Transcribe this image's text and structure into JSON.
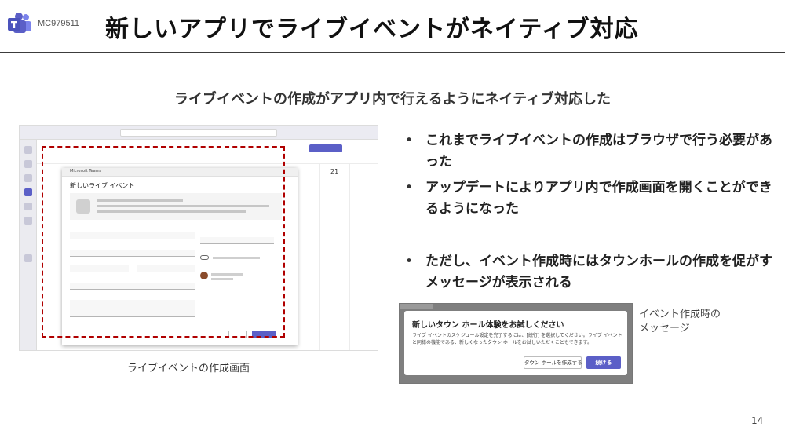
{
  "header": {
    "mc_id": "MC979511",
    "title": "新しいアプリでライブイベントがネイティブ対応"
  },
  "subtitle": "ライブイベントの作成がアプリ内で行えるようにネイティブ対応した",
  "left_caption": "ライブイベントの作成画面",
  "screenshot": {
    "window_label": "Microsoft Teams",
    "dialog_title": "新しいライブ イベント",
    "calendar_day": "21"
  },
  "bullets": [
    "これまでライブイベントの作成はブラウザで行う必要があった",
    "アップデートによりアプリ内で作成画面を開くことができるようになった",
    "ただし、イベント作成時にはタウンホールの作成を促がすメッセージが表示される"
  ],
  "message": {
    "title": "新しいタウン ホール体験をお試しください",
    "body": "ライブ イベントのスケジュール設定を完了するには、[続行] を選択してください。ライブ イベントと同様の機能である、新しくなったタウン ホールをお試しいただくこともできます。",
    "create_town_hall_label": "タウン ホールを作成する",
    "continue_label": "続ける"
  },
  "right_caption": [
    "イベント作成時の",
    "メッセージ"
  ],
  "page_number": "14",
  "colors": {
    "accent": "#5b5fc7",
    "dashed_frame": "#b00000"
  }
}
